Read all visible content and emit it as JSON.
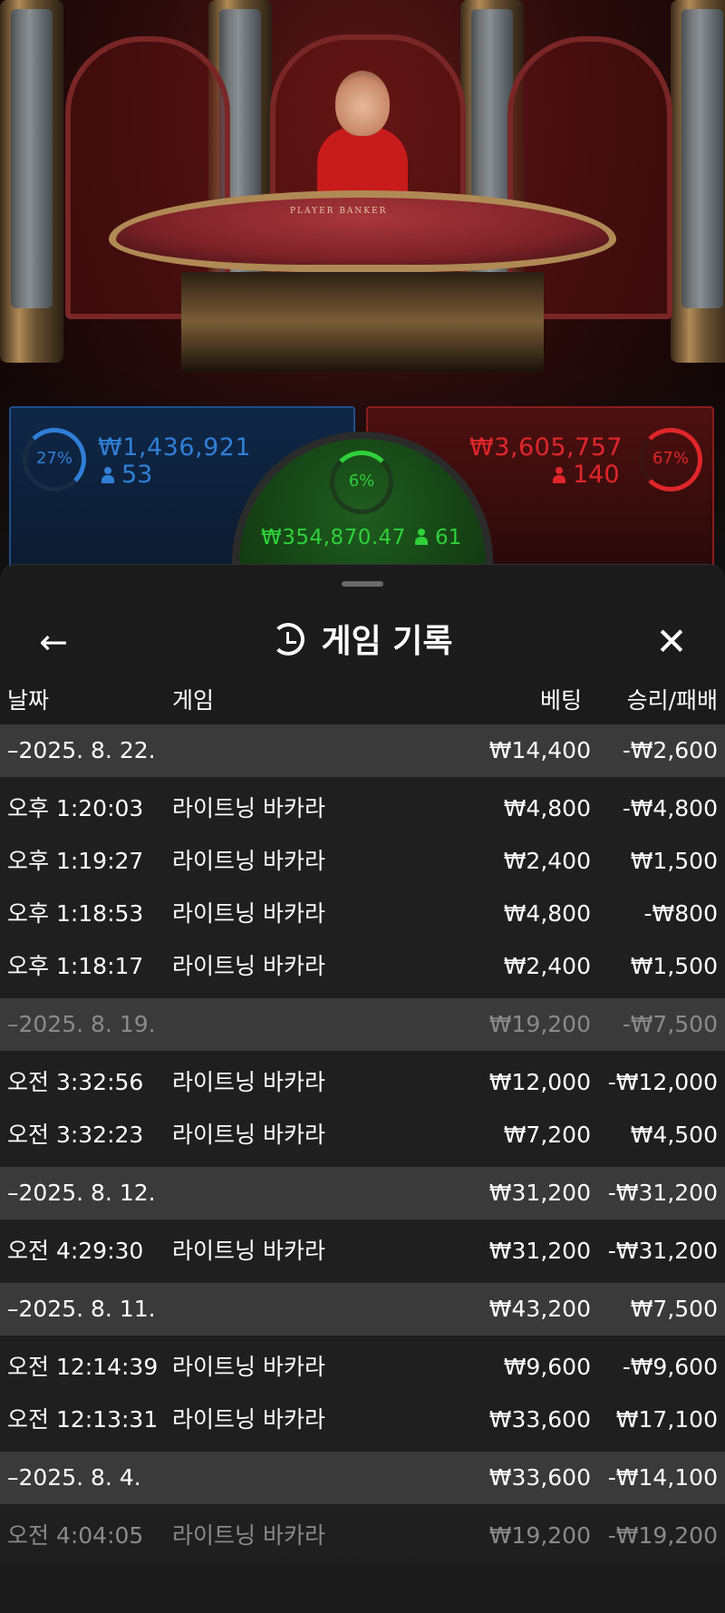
{
  "live_stream": {
    "table_label": "PLAYER    BANKER",
    "player": {
      "percent": "27%",
      "amount": "₩1,436,921",
      "players": "53",
      "color": "#2f7fd6"
    },
    "tie": {
      "percent": "6%",
      "amount": "₩354,870.47",
      "players": "61",
      "color": "#2fd03a"
    },
    "banker": {
      "percent": "67%",
      "amount": "₩3,605,757",
      "players": "140",
      "color": "#e0262a"
    }
  },
  "sheet": {
    "back_icon": "arrow-left-icon",
    "history_icon": "history-icon",
    "title": "게임 기록",
    "close_icon": "close-icon",
    "columns": {
      "date": "날짜",
      "game": "게임",
      "bet": "베팅",
      "result": "승리/패배"
    },
    "groups": [
      {
        "date": "–2025. 8. 22.",
        "bet": "₩14,400",
        "result": "-₩2,600",
        "rows": [
          {
            "time": "오후 1:20:03",
            "game": "라이트닝 바카라",
            "bet": "₩4,800",
            "result": "-₩4,800"
          },
          {
            "time": "오후 1:19:27",
            "game": "라이트닝 바카라",
            "bet": "₩2,400",
            "result": "₩1,500"
          },
          {
            "time": "오후 1:18:53",
            "game": "라이트닝 바카라",
            "bet": "₩4,800",
            "result": "-₩800"
          },
          {
            "time": "오후 1:18:17",
            "game": "라이트닝 바카라",
            "bet": "₩2,400",
            "result": "₩1,500"
          }
        ]
      },
      {
        "date": "–2025. 8. 19.",
        "bet": "₩19,200",
        "result": "-₩7,500",
        "dim": true,
        "rows": [
          {
            "time": "오전 3:32:56",
            "game": "라이트닝 바카라",
            "bet": "₩12,000",
            "result": "-₩12,000"
          },
          {
            "time": "오전 3:32:23",
            "game": "라이트닝 바카라",
            "bet": "₩7,200",
            "result": "₩4,500"
          }
        ]
      },
      {
        "date": "–2025. 8. 12.",
        "bet": "₩31,200",
        "result": "-₩31,200",
        "rows": [
          {
            "time": "오전 4:29:30",
            "game": "라이트닝 바카라",
            "bet": "₩31,200",
            "result": "-₩31,200"
          }
        ]
      },
      {
        "date": "–2025. 8. 11.",
        "bet": "₩43,200",
        "result": "₩7,500",
        "rows": [
          {
            "time": "오전 12:14:39",
            "game": "라이트닝 바카라",
            "bet": "₩9,600",
            "result": "-₩9,600"
          },
          {
            "time": "오전 12:13:31",
            "game": "라이트닝 바카라",
            "bet": "₩33,600",
            "result": "₩17,100"
          }
        ]
      },
      {
        "date": "–2025. 8. 4.",
        "bet": "₩33,600",
        "result": "-₩14,100",
        "rows": [
          {
            "time": "오전 4:04:05",
            "game": "라이트닝 바카라",
            "bet": "₩19,200",
            "result": "-₩19,200",
            "dim": true
          }
        ]
      }
    ]
  }
}
